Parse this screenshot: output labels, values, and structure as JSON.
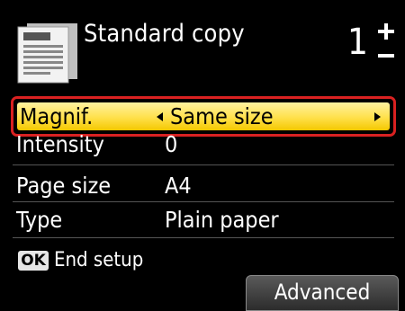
{
  "header": {
    "title": "Standard copy",
    "copies": "1"
  },
  "settings": {
    "selected": {
      "label": "Magnif.",
      "value": "Same size"
    },
    "intensity": {
      "label": "Intensity",
      "value": "0"
    },
    "page_size": {
      "label": "Page size",
      "value": "A4"
    },
    "type": {
      "label": "Type",
      "value": "Plain paper"
    }
  },
  "footer": {
    "ok_label": "OK",
    "end_setup": "End setup",
    "advanced": "Advanced"
  },
  "colors": {
    "highlight": "#ffe04a",
    "selection_border": "#d92121",
    "background": "#000000"
  },
  "icons": {
    "document": "document-icon",
    "stepper": "plus-minus-stepper-icon"
  }
}
